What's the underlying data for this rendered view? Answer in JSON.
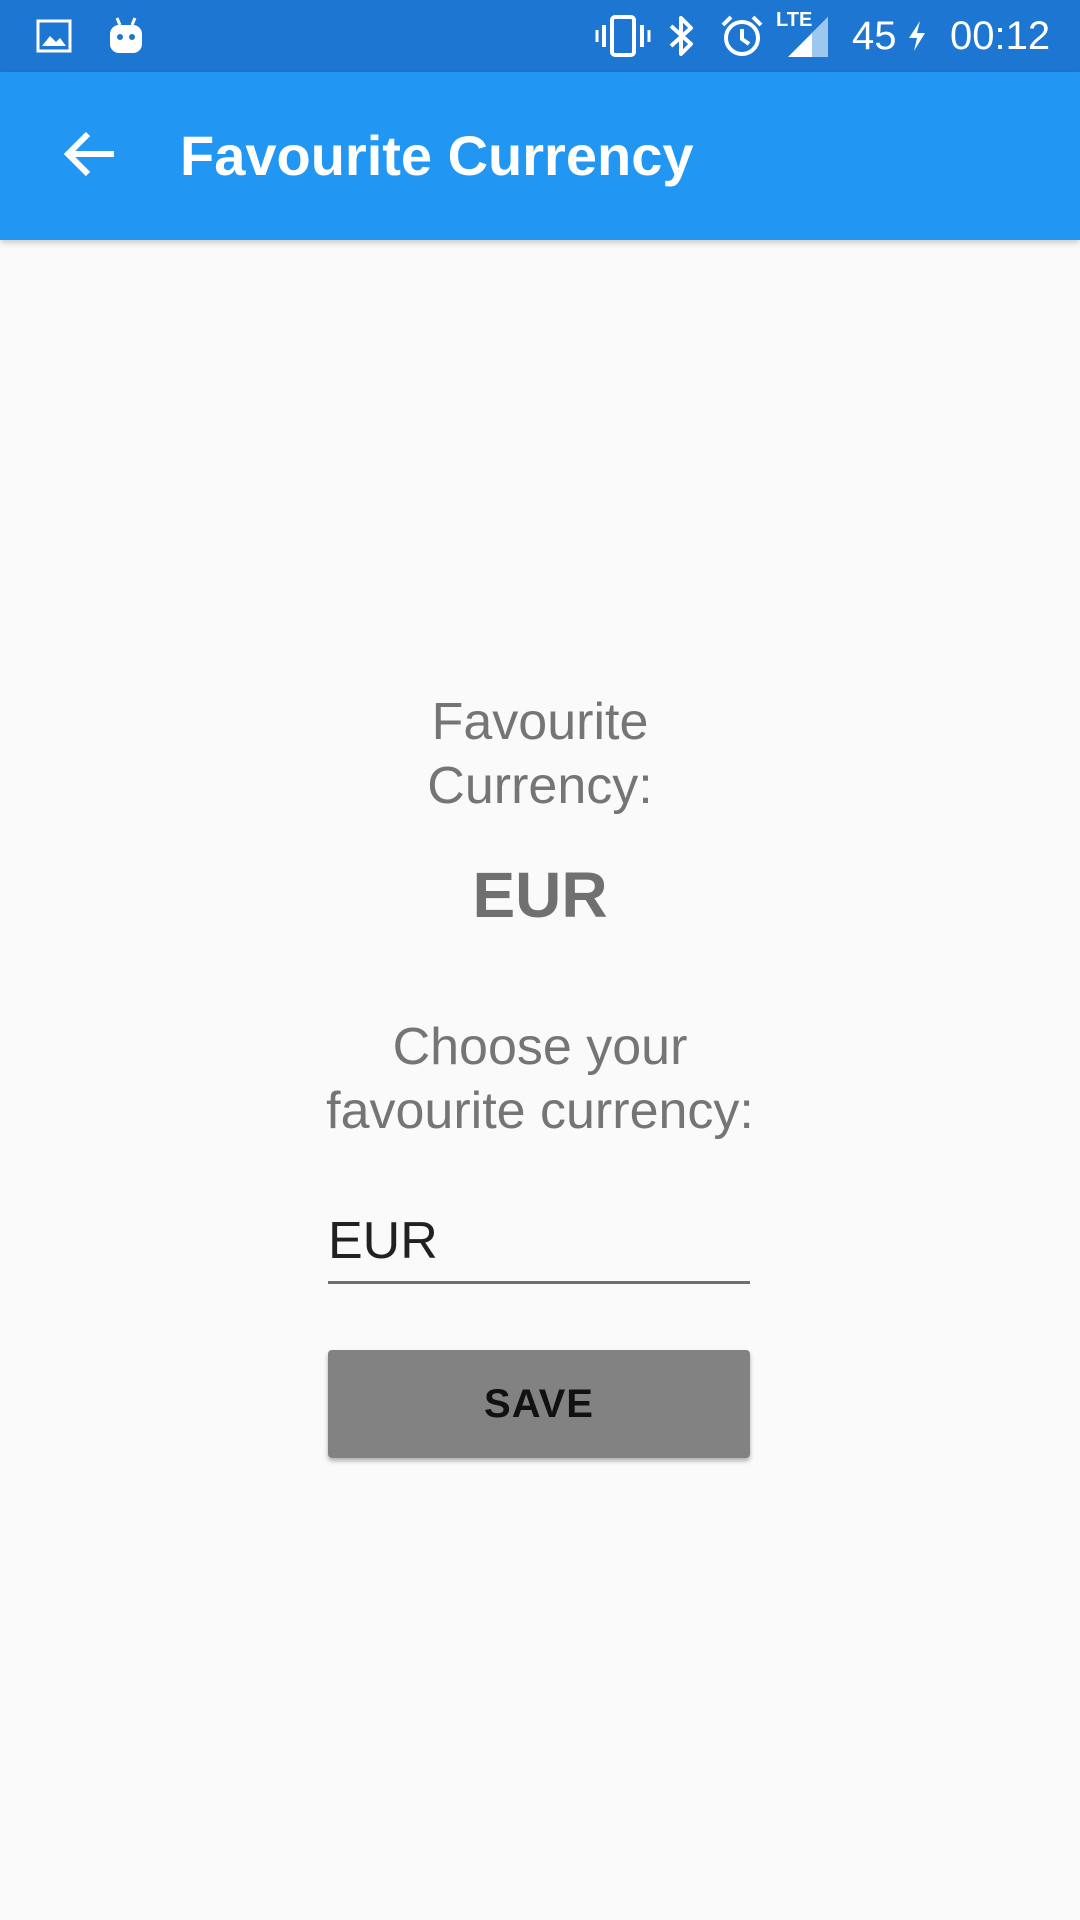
{
  "status_bar": {
    "icons_left": [
      "image-icon",
      "android-icon"
    ],
    "icons_right": [
      "vibrate-icon",
      "bluetooth-icon",
      "alarm-icon",
      "lte-signal-icon",
      "charging-icon"
    ],
    "lte_label": "LTE",
    "battery": "45",
    "time": "00:12",
    "color": "#1d76d2"
  },
  "app_bar": {
    "title": "Favourite Currency",
    "back_icon": "arrow-back-icon",
    "color": "#2196f3"
  },
  "main": {
    "favourite_label": "Favourite Currency:",
    "current_currency": "EUR",
    "choose_label": "Choose your favourite currency:",
    "input_value": "EUR",
    "save_label": "SAVE",
    "button_color": "#828282"
  }
}
